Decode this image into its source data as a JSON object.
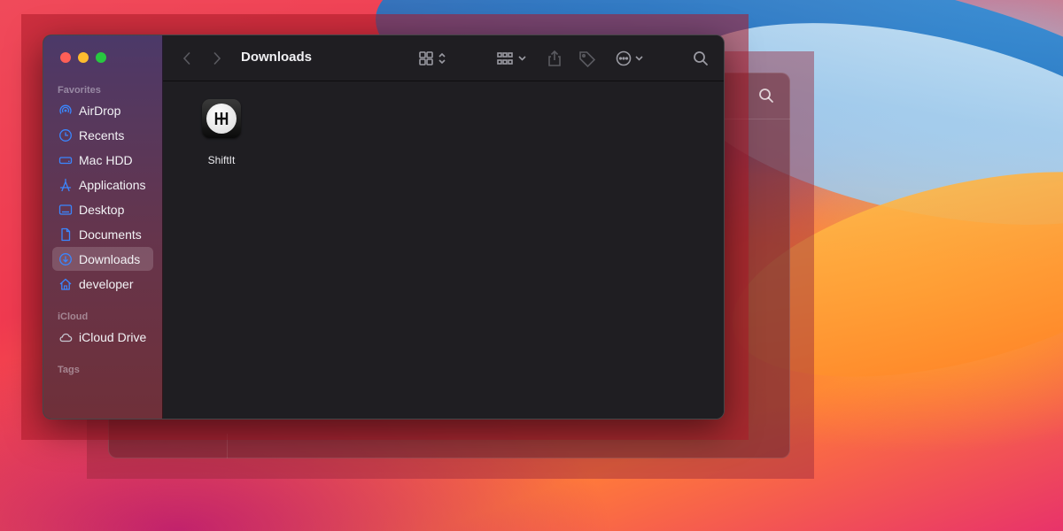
{
  "window": {
    "title": "Downloads"
  },
  "sidebar": {
    "sections": [
      {
        "title": "Favorites",
        "items": [
          {
            "label": "AirDrop",
            "icon": "airdrop-icon"
          },
          {
            "label": "Recents",
            "icon": "clock-icon"
          },
          {
            "label": "Mac HDD",
            "icon": "disk-icon"
          },
          {
            "label": "Applications",
            "icon": "applications-icon"
          },
          {
            "label": "Desktop",
            "icon": "desktop-icon"
          },
          {
            "label": "Documents",
            "icon": "document-icon"
          },
          {
            "label": "Downloads",
            "icon": "downloads-icon",
            "selected": true
          },
          {
            "label": "developer",
            "icon": "home-icon"
          }
        ]
      },
      {
        "title": "iCloud",
        "items": [
          {
            "label": "iCloud Drive",
            "icon": "cloud-icon"
          }
        ]
      },
      {
        "title": "Tags",
        "items": []
      }
    ]
  },
  "toolbar": {
    "buttons": [
      "back-icon",
      "forward-icon",
      "icon-view-icon",
      "group-icon",
      "share-icon",
      "tag-icon",
      "more-icon",
      "search-icon"
    ]
  },
  "files": [
    {
      "name": "ShiftIt",
      "icon": "shiftit-app-icon"
    }
  ],
  "colors": {
    "accent": "#3a86ff",
    "close": "#ff5f57",
    "minimize": "#febc2e",
    "zoom": "#28c840"
  }
}
